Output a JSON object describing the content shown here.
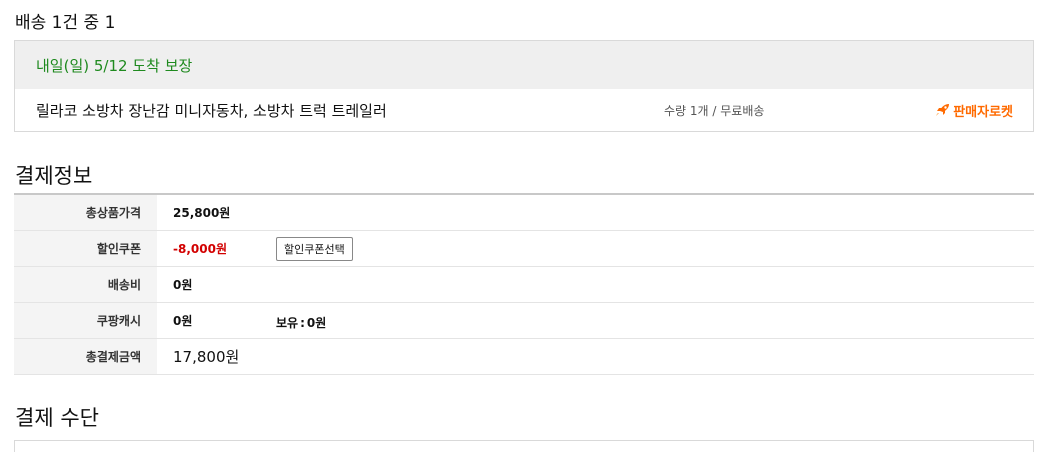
{
  "shipping": {
    "heading": "배송 1건 중 1",
    "delivery_date": "내일(일) 5/12 도착 보장",
    "product_name": "릴라코 소방차 장난감 미니자동차, 소방차 트럭 트레일러",
    "quantity_info": "수량 1개 / 무료배송",
    "seller_badge": "판매자로켓",
    "seller_badge_color": "#ff6a00",
    "delivery_date_color": "#1f8a1f"
  },
  "payment_info": {
    "title": "결제정보",
    "rows": {
      "total_product_price": {
        "label": "총상품가격",
        "value": "25,800원"
      },
      "discount_coupon": {
        "label": "할인쿠폰",
        "value": "-8,000원",
        "button_label": "할인쿠폰선택",
        "value_color": "#d20000"
      },
      "shipping_fee": {
        "label": "배송비",
        "value": "0원"
      },
      "coupang_cash": {
        "label": "쿠팡캐시",
        "value": "0원",
        "holding_label": "보유",
        "holding_sep": ":",
        "holding_value": "0원"
      },
      "total_payment": {
        "label": "총결제금액",
        "value": "17,800원"
      }
    }
  },
  "payment_method": {
    "title": "결제 수단"
  }
}
